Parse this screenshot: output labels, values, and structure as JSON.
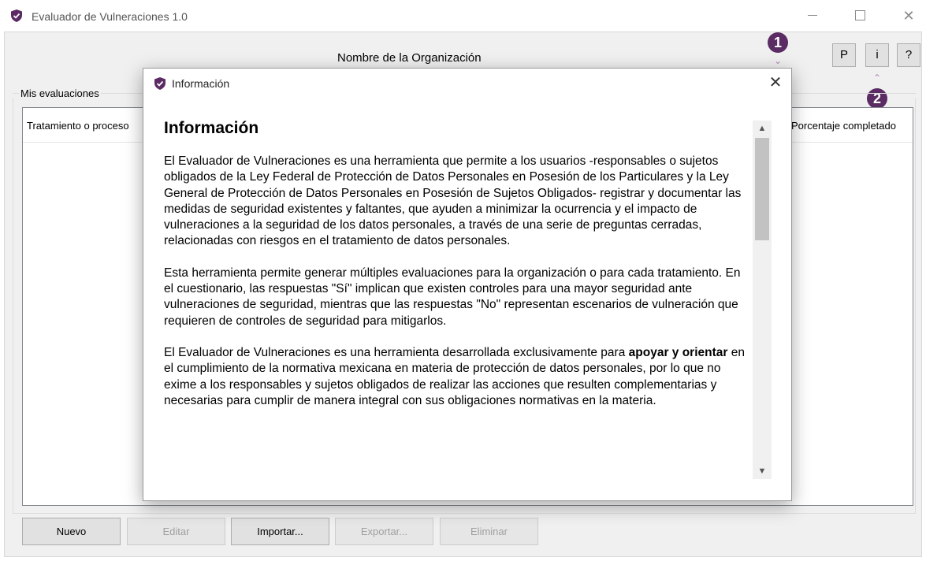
{
  "window": {
    "title": "Evaluador de Vulneraciones 1.0",
    "accent_color": "#5b2c63"
  },
  "header": {
    "organization_name": "Nombre de la Organización",
    "toolbar": {
      "p_label": "P",
      "info_label": "i",
      "help_label": "?"
    },
    "annotations": {
      "badge1": "1",
      "badge2": "2"
    }
  },
  "evaluations": {
    "group_label": "Mis evaluaciones",
    "columns": [
      "Tratamiento o proceso",
      "Porcentaje completado"
    ]
  },
  "buttons": {
    "nuevo": "Nuevo",
    "editar": "Editar",
    "importar": "Importar...",
    "exportar": "Exportar...",
    "eliminar": "Eliminar"
  },
  "dialog": {
    "title": "Información",
    "heading": "Información",
    "paragraphs": [
      "El Evaluador de Vulneraciones es una herramienta que permite a los usuarios -responsables o sujetos obligados de la Ley Federal de Protección de Datos Personales en Posesión de los Particulares y la Ley General de Protección de Datos Personales en Posesión de Sujetos Obligados- registrar y documentar las medidas de seguridad existentes y faltantes, que ayuden a minimizar la ocurrencia y el impacto de vulneraciones a la seguridad de los datos personales, a través de una serie de preguntas cerradas, relacionadas con riesgos en el tratamiento de datos personales.",
      "Esta herramienta permite generar múltiples evaluaciones para la organización o para cada tratamiento. En el cuestionario, las respuestas \"Sí\" implican que existen controles para una mayor seguridad ante vulneraciones de seguridad, mientras que las respuestas \"No\" representan escenarios de vulneración que requieren de controles de seguridad para mitigarlos."
    ],
    "p3": {
      "before": "El Evaluador de Vulneraciones es una herramienta desarrollada exclusivamente para ",
      "bold": "apoyar y orientar",
      "after": " en el cumplimiento de la normativa mexicana en materia de protección de datos personales, por lo que no exime a los responsables y sujetos obligados de realizar las acciones que resulten complementarias y necesarias para cumplir de manera integral con sus obligaciones normativas en la materia."
    }
  }
}
